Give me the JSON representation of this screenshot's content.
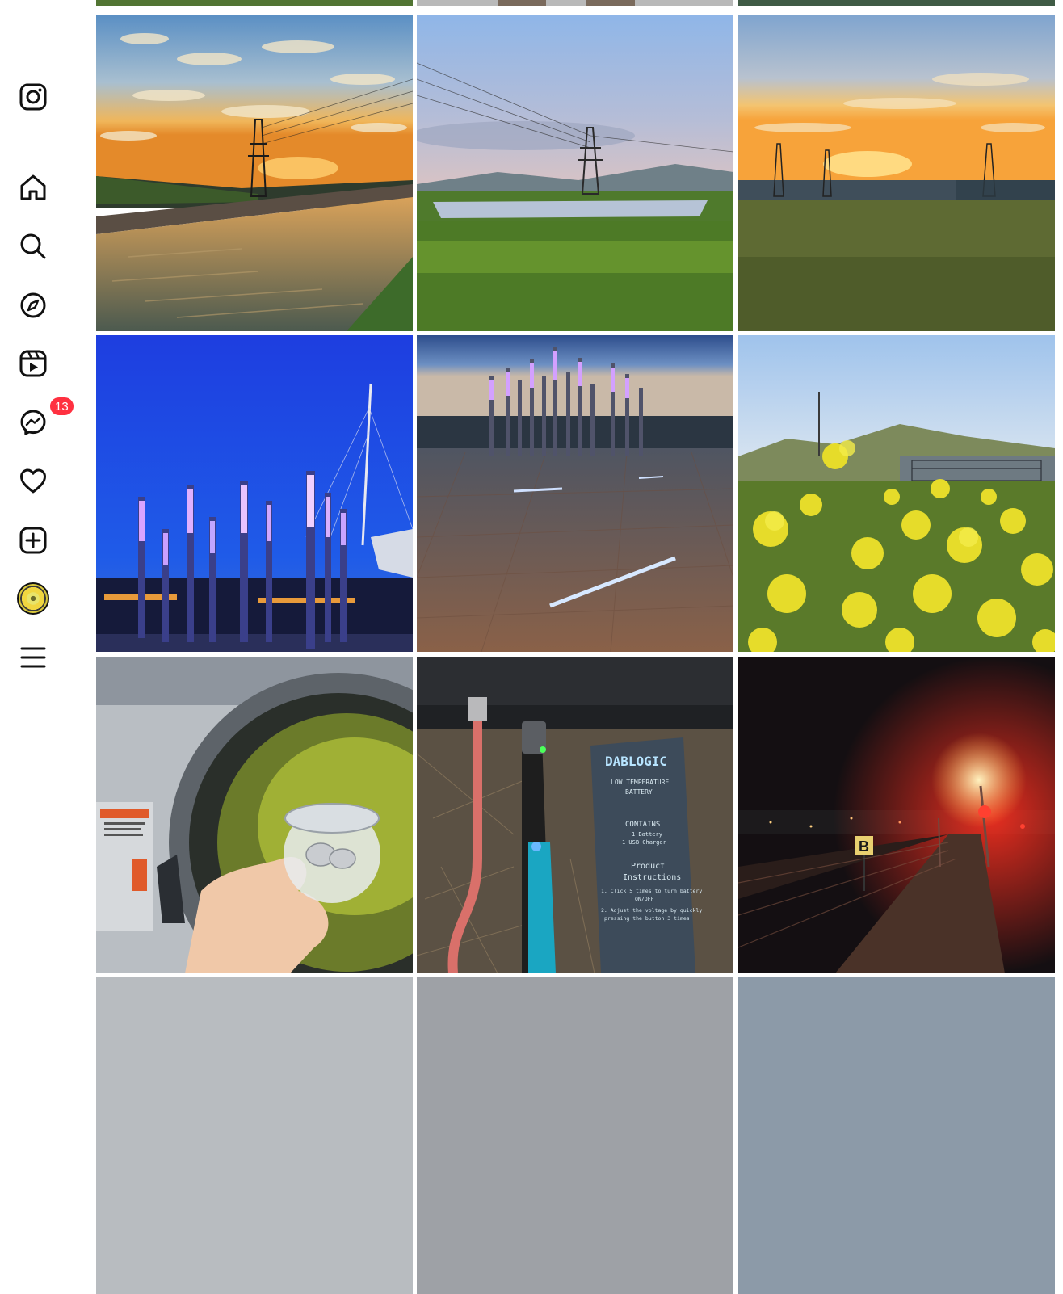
{
  "sidebar": {
    "logo_icon": "instagram-logo-icon",
    "items": [
      {
        "name": "home",
        "icon": "home-icon"
      },
      {
        "name": "search",
        "icon": "search-icon"
      },
      {
        "name": "explore",
        "icon": "compass-icon"
      },
      {
        "name": "reels",
        "icon": "reels-icon"
      },
      {
        "name": "messages",
        "icon": "messenger-icon",
        "badge": "13"
      },
      {
        "name": "notifications",
        "icon": "heart-icon"
      },
      {
        "name": "create",
        "icon": "plus-square-icon"
      },
      {
        "name": "profile",
        "icon": "avatar"
      },
      {
        "name": "more",
        "icon": "hamburger-menu-icon"
      }
    ]
  },
  "feed": {
    "rows_visible": 5,
    "posts": [
      {
        "id": "sunset-canal-towers"
      },
      {
        "id": "power-lines-wetland"
      },
      {
        "id": "sunset-substation-field"
      },
      {
        "id": "light-poles-bridge-night"
      },
      {
        "id": "light-poles-plaza-dusk"
      },
      {
        "id": "yellow-mustard-flowers"
      },
      {
        "id": "laundromat-coins-jar"
      },
      {
        "id": "vape-battery-box"
      },
      {
        "id": "night-railway-platform"
      }
    ]
  },
  "box_text": {
    "brand": "DABLOGIC",
    "line1": "LOW TEMPERATURE",
    "line2": "BATTERY",
    "contains": "CONTAINS",
    "c1": "1 Battery",
    "c2": "1 USB Charger",
    "product": "Product",
    "instructions": "Instructions",
    "i1": "1. Click 5 times to turn battery",
    "i1b": "ON/OFF",
    "i2": "2. Adjust the voltage by quickly",
    "i2b": "pressing the button 3 times"
  },
  "platform_sign": "B",
  "colors": {
    "badge": "#ff3040",
    "divider": "#dbdbdb"
  }
}
